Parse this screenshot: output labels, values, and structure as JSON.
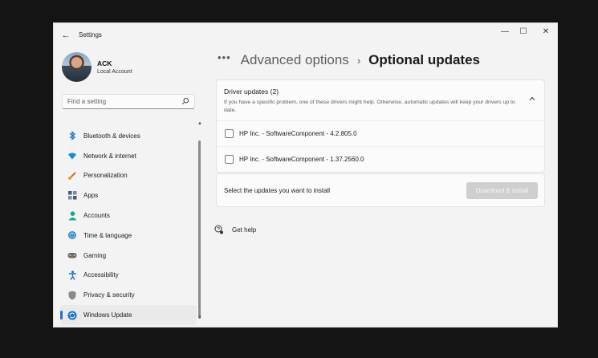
{
  "window": {
    "title": "Settings",
    "controls": {
      "minimize": "—",
      "maximize": "☐",
      "close": "✕"
    }
  },
  "profile": {
    "name": "ACK",
    "account_type": "Local Account"
  },
  "search": {
    "placeholder": "Find a setting"
  },
  "sidebar": {
    "items": [
      {
        "label": "Bluetooth & devices",
        "icon": "bluetooth-icon",
        "color": "#1a73c8"
      },
      {
        "label": "Network & internet",
        "icon": "wifi-icon",
        "color": "#1a8ad8"
      },
      {
        "label": "Personalization",
        "icon": "brush-icon",
        "color": "#d06a2a"
      },
      {
        "label": "Apps",
        "icon": "apps-icon",
        "color": "#4a5a78"
      },
      {
        "label": "Accounts",
        "icon": "person-icon",
        "color": "#1aa78a"
      },
      {
        "label": "Time & language",
        "icon": "globe-clock-icon",
        "color": "#2a8ad0"
      },
      {
        "label": "Gaming",
        "icon": "controller-icon",
        "color": "#6a6a6a"
      },
      {
        "label": "Accessibility",
        "icon": "accessibility-icon",
        "color": "#1a73c8"
      },
      {
        "label": "Privacy & security",
        "icon": "shield-icon",
        "color": "#7a7a7a"
      },
      {
        "label": "Windows Update",
        "icon": "sync-icon",
        "color": "#1a73c8",
        "selected": true
      }
    ]
  },
  "breadcrumb": {
    "more": "•••",
    "parent": "Advanced options",
    "separator": "›",
    "current": "Optional updates"
  },
  "driver_updates": {
    "title": "Driver updates (2)",
    "description": "If you have a specific problem, one of these drivers might help. Otherwise, automatic updates will keep your drivers up to date.",
    "items": [
      {
        "label": "HP Inc. - SoftwareComponent - 4.2.805.0",
        "checked": false
      },
      {
        "label": "HP Inc. - SoftwareComponent - 1.37.2560.0",
        "checked": false
      }
    ]
  },
  "install": {
    "prompt": "Select the updates you want to install",
    "button_label": "Download & install"
  },
  "help": {
    "label": "Get help"
  },
  "colors": {
    "accent": "#1a73c8",
    "background": "#f3f3f3",
    "button_disabled": "#cfcfcf"
  }
}
